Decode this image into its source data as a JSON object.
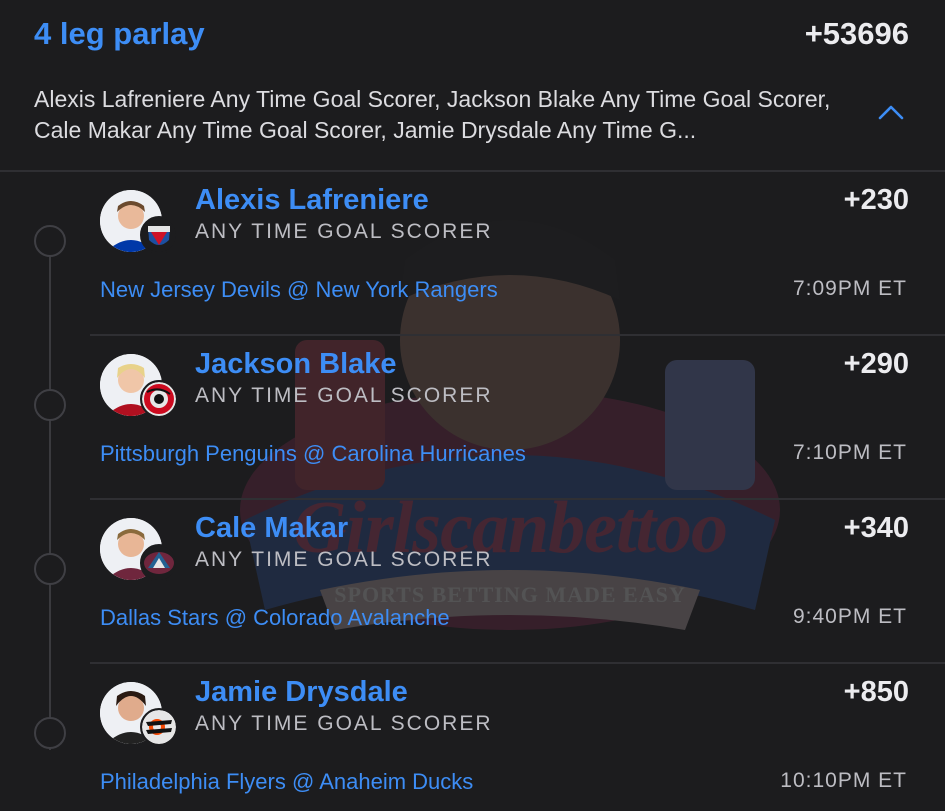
{
  "parlay": {
    "title": "4 leg parlay",
    "odds": "+53696",
    "summary": "Alexis Lafreniere Any Time Goal Scorer, Jackson Blake Any Time Goal Scorer, Cale Makar Any Time Goal Scorer, Jamie Drysdale Any Time G...",
    "collapse_icon": "chevron-up-icon"
  },
  "watermark": {
    "brand": "Girlscanbettoo",
    "tagline": "SPORTS BETTING MADE EASY"
  },
  "legs": [
    {
      "player": "Alexis Lafreniere",
      "market": "ANY TIME GOAL SCORER",
      "odds": "+230",
      "matchup": "New Jersey Devils @ New York Rangers",
      "time": "7:09PM ET",
      "team_logo": "rangers-logo-icon",
      "team_color": "#1c4fa1"
    },
    {
      "player": "Jackson Blake",
      "market": "ANY TIME GOAL SCORER",
      "odds": "+290",
      "matchup": "Pittsburgh Penguins @ Carolina Hurricanes",
      "time": "7:10PM ET",
      "team_logo": "hurricanes-logo-icon",
      "team_color": "#cc0a1f"
    },
    {
      "player": "Cale Makar",
      "market": "ANY TIME GOAL SCORER",
      "odds": "+340",
      "matchup": "Dallas Stars @ Colorado Avalanche",
      "time": "9:40PM ET",
      "team_logo": "avalanche-logo-icon",
      "team_color": "#6f263d"
    },
    {
      "player": "Jamie Drysdale",
      "market": "ANY TIME GOAL SCORER",
      "odds": "+850",
      "matchup": "Philadelphia Flyers @ Anaheim Ducks",
      "time": "10:10PM ET",
      "team_logo": "flyers-logo-icon",
      "team_color": "#f74902"
    }
  ]
}
